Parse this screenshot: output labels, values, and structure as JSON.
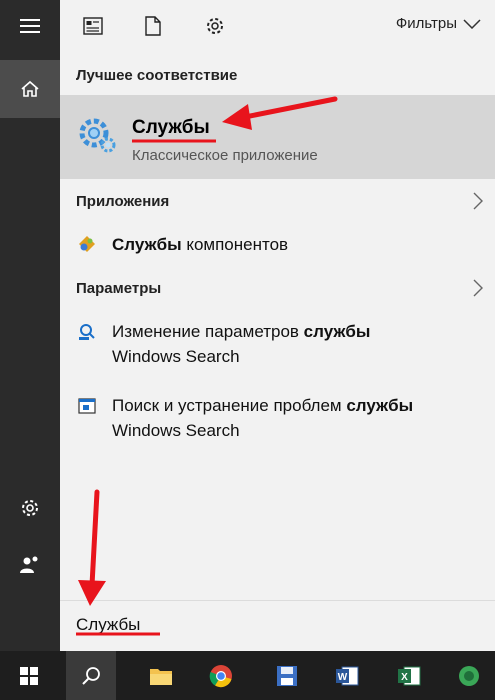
{
  "toolbar": {
    "filters_label": "Фильтры"
  },
  "best_match": {
    "header": "Лучшее соответствие",
    "title": "Службы",
    "subtitle": "Классическое приложение"
  },
  "apps": {
    "header": "Приложения",
    "item": {
      "bold": "Службы",
      "rest": " компонентов"
    }
  },
  "settings": {
    "header": "Параметры",
    "items": [
      {
        "line1_prefix": "Изменение параметров ",
        "line1_bold": "службы",
        "line2": "Windows Search"
      },
      {
        "line1_prefix": "Поиск и устранение проблем ",
        "line1_bold": "службы",
        "line2": "Windows Search"
      }
    ]
  },
  "search": {
    "query": "Службы"
  },
  "colors": {
    "accent_red": "#e8141c",
    "rail_bg": "#2b2b2b",
    "panel_bg": "#f2f2f2",
    "highlight_bg": "#d6d6d6"
  },
  "icons": [
    "hamburger-icon",
    "home-icon",
    "gear-icon",
    "user-icon",
    "document-icon",
    "blank-page-icon",
    "chevron-down-icon",
    "chevron-right-icon",
    "services-gear-icon",
    "windows-logo-icon",
    "search-icon",
    "folder-icon",
    "chrome-icon",
    "word-icon",
    "excel-icon"
  ]
}
